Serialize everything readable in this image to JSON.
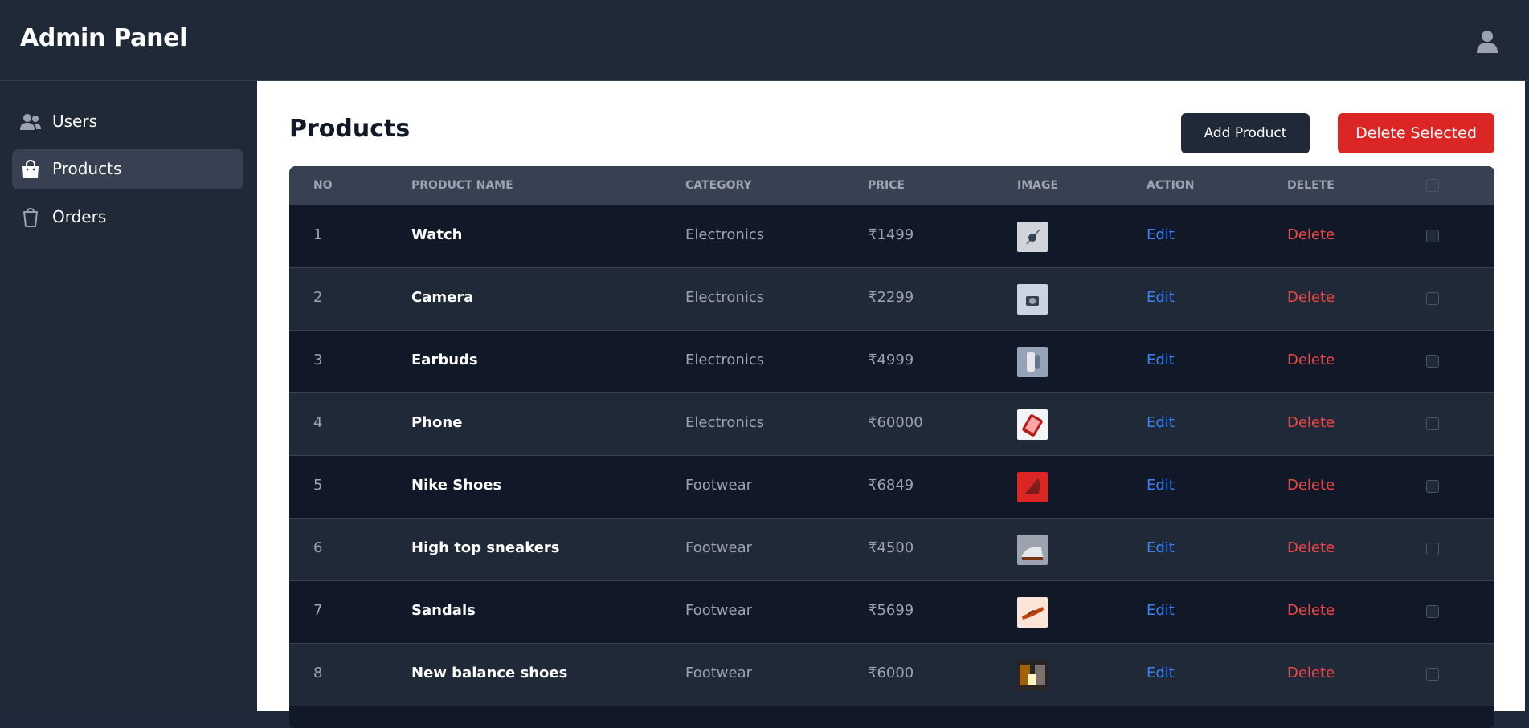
{
  "header": {
    "title": "Admin Panel",
    "user_icon": "user-icon"
  },
  "sidebar": {
    "items": [
      {
        "label": "Users",
        "icon": "users-icon",
        "active": false
      },
      {
        "label": "Products",
        "icon": "shopping-bag-icon",
        "active": true
      },
      {
        "label": "Orders",
        "icon": "cart-icon",
        "active": false
      }
    ]
  },
  "main": {
    "title": "Products",
    "add_button": "Add Product",
    "delete_selected_button": "Delete Selected",
    "table": {
      "columns": [
        "NO",
        "PRODUCT NAME",
        "CATEGORY",
        "PRICE",
        "IMAGE",
        "ACTION",
        "DELETE"
      ],
      "rows": [
        {
          "no": "1",
          "name": "Watch",
          "category": "Electronics",
          "price": "₹1499",
          "image": "watch-thumbnail",
          "action": "Edit",
          "delete": "Delete"
        },
        {
          "no": "2",
          "name": "Camera",
          "category": "Electronics",
          "price": "₹2299",
          "image": "camera-thumbnail",
          "action": "Edit",
          "delete": "Delete"
        },
        {
          "no": "3",
          "name": "Earbuds",
          "category": "Electronics",
          "price": "₹4999",
          "image": "earbuds-thumbnail",
          "action": "Edit",
          "delete": "Delete"
        },
        {
          "no": "4",
          "name": "Phone",
          "category": "Electronics",
          "price": "₹60000",
          "image": "phone-thumbnail",
          "action": "Edit",
          "delete": "Delete"
        },
        {
          "no": "5",
          "name": "Nike Shoes",
          "category": "Footwear",
          "price": "₹6849",
          "image": "nike-shoes-thumbnail",
          "action": "Edit",
          "delete": "Delete"
        },
        {
          "no": "6",
          "name": "High top sneakers",
          "category": "Footwear",
          "price": "₹4500",
          "image": "sneakers-thumbnail",
          "action": "Edit",
          "delete": "Delete"
        },
        {
          "no": "7",
          "name": "Sandals",
          "category": "Footwear",
          "price": "₹5699",
          "image": "sandals-thumbnail",
          "action": "Edit",
          "delete": "Delete"
        },
        {
          "no": "8",
          "name": "New balance shoes",
          "category": "Footwear",
          "price": "₹6000",
          "image": "new-balance-thumbnail",
          "action": "Edit",
          "delete": "Delete"
        }
      ]
    }
  },
  "colors": {
    "header_bg": "#1f2937",
    "sidebar_bg": "#1f2937",
    "row_dark": "#111827",
    "row_light": "#1f2937",
    "edit_link": "#3b82f6",
    "delete_link": "#ef4444",
    "delete_selected_bg": "#dc2626"
  }
}
